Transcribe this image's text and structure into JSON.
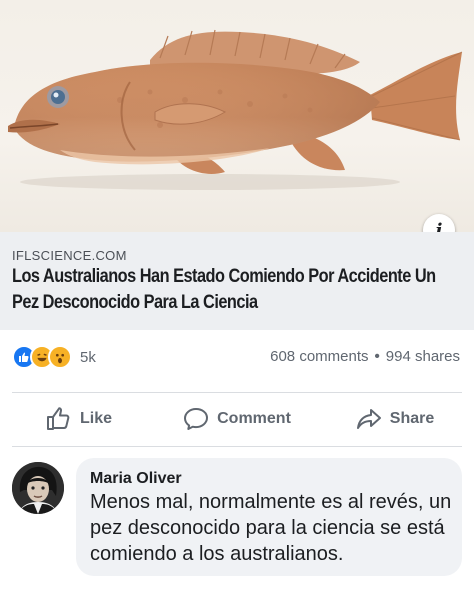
{
  "link_preview": {
    "image_subject": "fish",
    "info_label": "i",
    "source": "IFLSCIENCE.COM",
    "headline": "Los Australianos Han Estado Comiendo Por Accidente Un Pez Desconocido Para La Ciencia"
  },
  "reactions": {
    "icons": [
      "like-icon",
      "haha-icon",
      "wow-icon"
    ],
    "count": "5k",
    "comments": "608 comments",
    "separator": "•",
    "shares": "994 shares"
  },
  "actions": {
    "like_label": "Like",
    "comment_label": "Comment",
    "share_label": "Share"
  },
  "comment": {
    "author": "Maria Oliver",
    "text": "Menos mal, normalmente es al revés, un pez desconocido para la ciencia se está comiendo a los australianos."
  },
  "colors": {
    "accent": "#1877f2",
    "meta_background": "#edeff2",
    "comment_bubble": "#f0f2f5",
    "secondary_text": "#606770"
  }
}
